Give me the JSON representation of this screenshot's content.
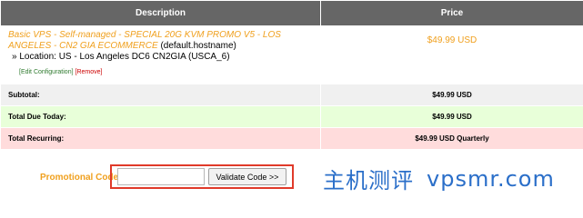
{
  "cart": {
    "headers": {
      "description": "Description",
      "price": "Price"
    },
    "item": {
      "name_prefix": "Basic VPS - Self-managed",
      "name_main": " - SPECIAL 20G KVM PROMO V5 - LOS ANGELES - CN2 GIA ECOMMERCE",
      "hostname": " (default.hostname)",
      "option": "» Location: US - Los Angeles DC6 CN2GIA (USCA_6)",
      "edit_link": "[Edit Configuration]",
      "remove_link": "[Remove]",
      "price": "$49.99 USD"
    },
    "subtotal": {
      "label": "Subtotal:",
      "value": "$49.99 USD"
    },
    "due_today": {
      "label": "Total Due Today:",
      "value": "$49.99 USD"
    },
    "recurring": {
      "label": "Total Recurring:",
      "value": "$49.99 USD Quarterly"
    }
  },
  "promo": {
    "label": "Promotional Code",
    "input_value": "",
    "button_label": "Validate Code >>"
  },
  "watermark": {
    "text_cn": "主机测评",
    "text_site": "vpsmr.com"
  },
  "colors": {
    "header_bg": "#666666",
    "accent_orange": "#f0a01e",
    "due_bg": "#e8ffd9",
    "recurring_bg": "#ffdcdc",
    "highlight_red": "#e03a2a",
    "watermark_blue": "#2b6fc9"
  }
}
